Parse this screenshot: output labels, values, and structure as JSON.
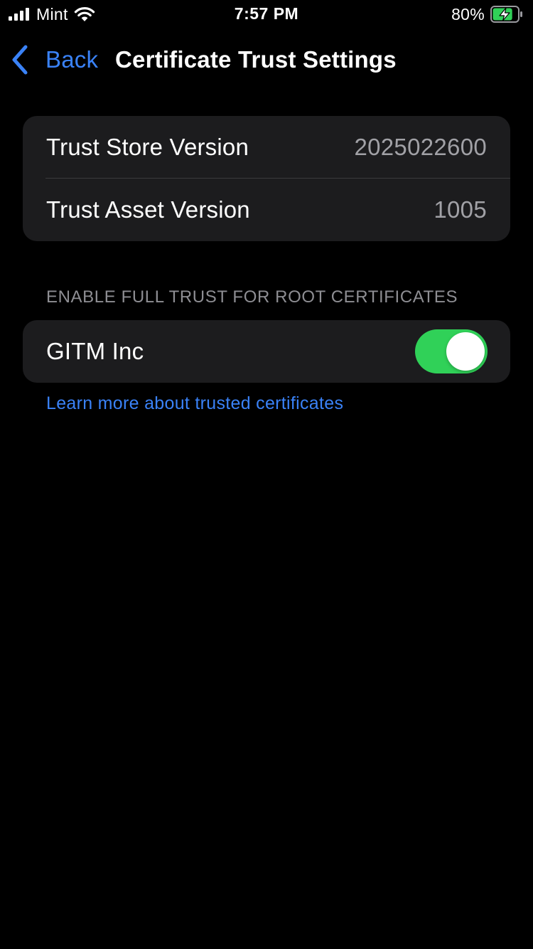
{
  "status_bar": {
    "carrier": "Mint",
    "time": "7:57 PM",
    "battery_percent": "80%",
    "signal_bars": 4,
    "battery_level": 0.8,
    "battery_charging": true,
    "battery_color": "#30d158"
  },
  "nav": {
    "back_label": "Back",
    "title": "Certificate Trust Settings",
    "accent_color": "#3a82f7"
  },
  "info_rows": [
    {
      "label": "Trust Store Version",
      "value": "2025022600"
    },
    {
      "label": "Trust Asset Version",
      "value": "1005"
    }
  ],
  "trust_section": {
    "header": "ENABLE FULL TRUST FOR ROOT CERTIFICATES",
    "certificates": [
      {
        "name": "GITM Inc",
        "enabled": true
      }
    ],
    "toggle_on_color": "#30d158"
  },
  "learn_more_link": "Learn more about trusted certificates"
}
